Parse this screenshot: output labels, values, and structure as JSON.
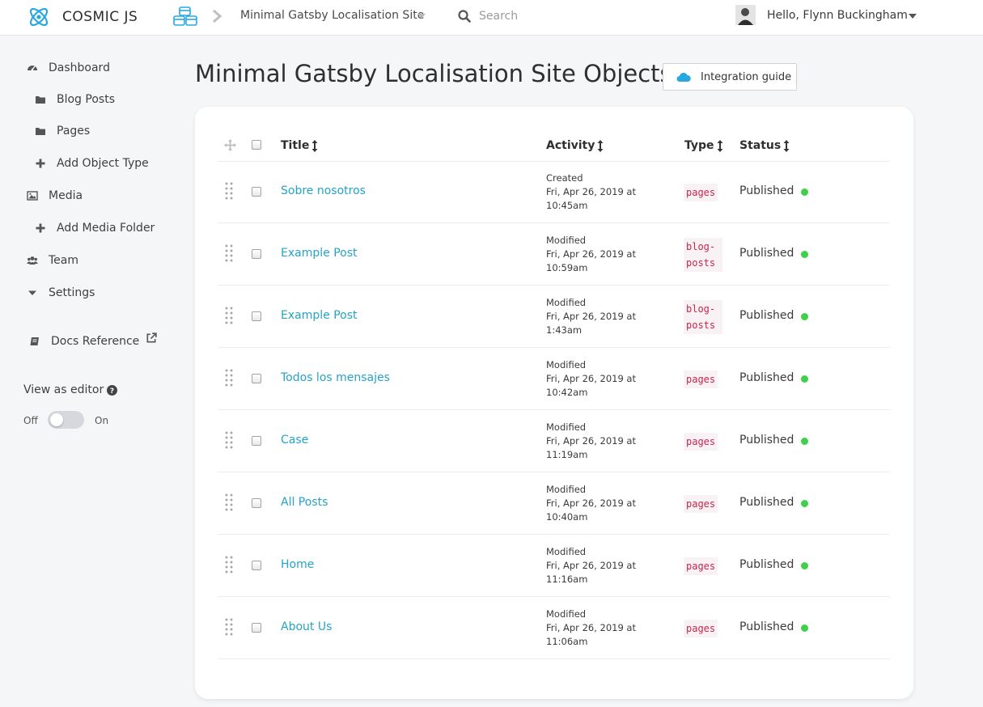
{
  "brand": {
    "name": "COSMIC JS",
    "accent": "#29a8e0"
  },
  "header": {
    "bucket_name": "Minimal Gatsby Localisation Site",
    "search_placeholder": "Search",
    "greeting": "Hello, Flynn Buckingham"
  },
  "sidebar": {
    "items": [
      {
        "label": "Dashboard",
        "icon": "dashboard-icon"
      },
      {
        "label": "Blog Posts",
        "icon": "folder-icon"
      },
      {
        "label": "Pages",
        "icon": "folder-icon"
      },
      {
        "label": "Add Object Type",
        "icon": "plus-icon"
      },
      {
        "label": "Media",
        "icon": "image-icon"
      },
      {
        "label": "Add Media Folder",
        "icon": "plus-icon"
      },
      {
        "label": "Team",
        "icon": "team-icon"
      },
      {
        "label": "Settings",
        "icon": "caret-down-icon"
      },
      {
        "label": "Docs Reference",
        "icon": "book-icon"
      }
    ],
    "editor_toggle": {
      "label": "View as editor",
      "off": "Off",
      "on": "On",
      "enabled": false
    }
  },
  "main": {
    "title": "Minimal Gatsby Localisation Site Objects",
    "integration_button": "Integration guide",
    "columns": {
      "title": "Title",
      "activity": "Activity",
      "type": "Type",
      "status": "Status"
    },
    "rows": [
      {
        "title": "Sobre nosotros",
        "action": "Created",
        "date": "Fri, Apr 26, 2019 at",
        "time": "10:45am",
        "type": "pages",
        "status": "Published"
      },
      {
        "title": "Example Post",
        "action": "Modified",
        "date": "Fri, Apr 26, 2019 at",
        "time": "10:59am",
        "type": "blog-posts",
        "status": "Published"
      },
      {
        "title": "Example Post",
        "action": "Modified",
        "date": "Fri, Apr 26, 2019 at",
        "time": "1:43am",
        "type": "blog-posts",
        "status": "Published"
      },
      {
        "title": "Todos los mensajes",
        "action": "Modified",
        "date": "Fri, Apr 26, 2019 at",
        "time": "10:42am",
        "type": "pages",
        "status": "Published"
      },
      {
        "title": "Case",
        "action": "Modified",
        "date": "Fri, Apr 26, 2019 at",
        "time": "11:19am",
        "type": "pages",
        "status": "Published"
      },
      {
        "title": "All Posts",
        "action": "Modified",
        "date": "Fri, Apr 26, 2019 at",
        "time": "10:40am",
        "type": "pages",
        "status": "Published"
      },
      {
        "title": "Home",
        "action": "Modified",
        "date": "Fri, Apr 26, 2019 at",
        "time": "11:16am",
        "type": "pages",
        "status": "Published"
      },
      {
        "title": "About Us",
        "action": "Modified",
        "date": "Fri, Apr 26, 2019 at",
        "time": "11:06am",
        "type": "pages",
        "status": "Published"
      }
    ]
  },
  "colors": {
    "link": "#25a3c5",
    "published_dot": "#3fd04a",
    "type_text": "#c7254e"
  }
}
